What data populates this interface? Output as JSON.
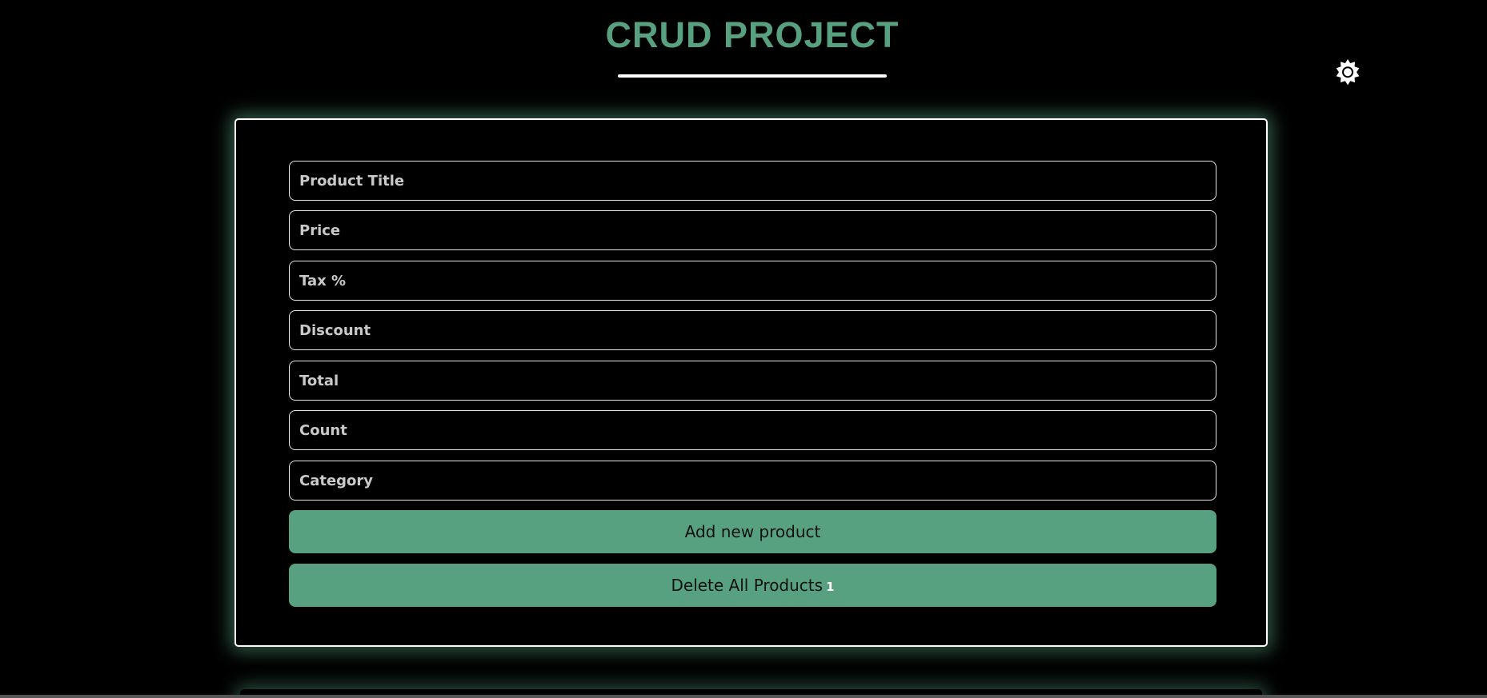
{
  "header": {
    "title": "CRUD PROJECT"
  },
  "theme_toggle": {
    "icon": "sun-gear-icon"
  },
  "form": {
    "fields": [
      {
        "name": "product-title-input",
        "placeholder": "Product Title",
        "value": ""
      },
      {
        "name": "price-input",
        "placeholder": "Price",
        "value": ""
      },
      {
        "name": "tax-input",
        "placeholder": "Tax %",
        "value": ""
      },
      {
        "name": "discount-input",
        "placeholder": "Discount",
        "value": ""
      },
      {
        "name": "total-input",
        "placeholder": "Total",
        "value": ""
      },
      {
        "name": "count-input",
        "placeholder": "Count",
        "value": ""
      },
      {
        "name": "category-input",
        "placeholder": "Category",
        "value": ""
      }
    ],
    "add_button_label": "Add new product",
    "delete_all_label": "Delete All Products",
    "delete_all_count": "1"
  },
  "colors": {
    "accent": "#57a080",
    "background": "#000000",
    "border": "#ffffff"
  }
}
